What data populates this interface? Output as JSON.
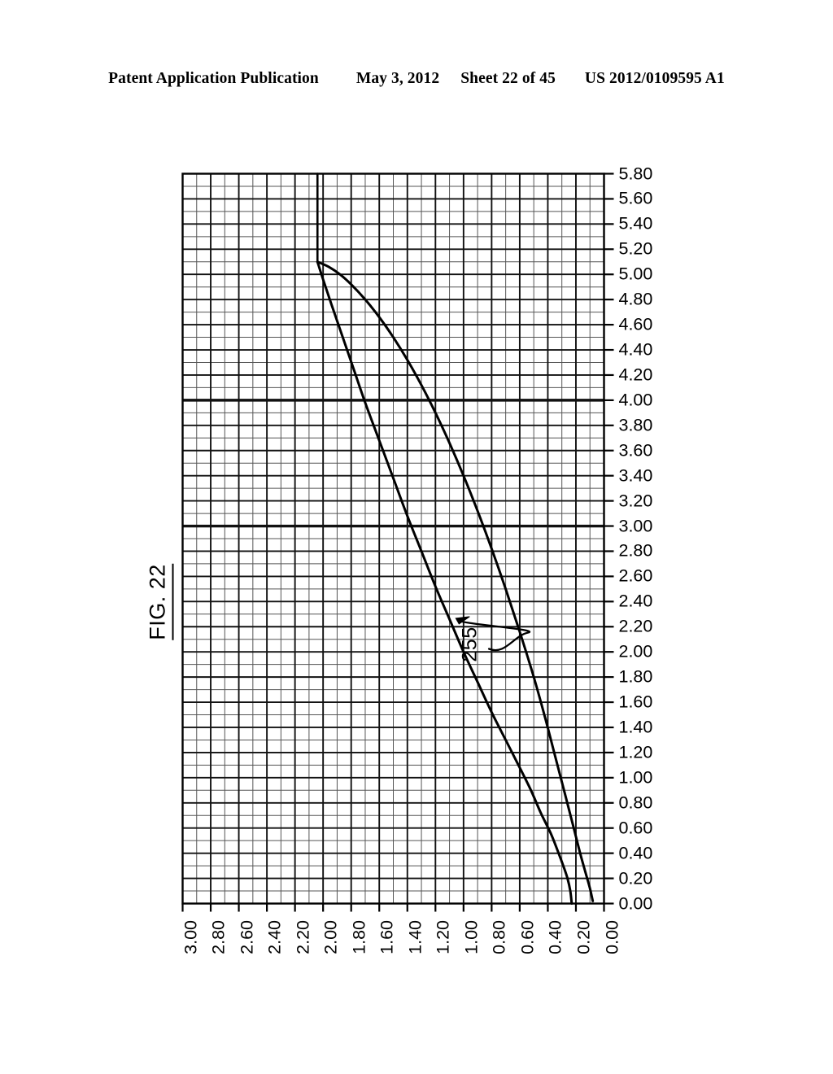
{
  "header": {
    "publication": "Patent Application Publication",
    "date": "May 3, 2012",
    "sheet": "Sheet 22 of 45",
    "patent_number": "US 2012/0109595 A1"
  },
  "figure": {
    "caption": "FIG. 22",
    "reference_numeral": "255"
  },
  "chart_data": {
    "type": "line",
    "title": "FIG. 22",
    "xlabel": "",
    "ylabel": "",
    "grid": true,
    "legend": null,
    "xlim": [
      3.0,
      0.0
    ],
    "ylim": [
      0.0,
      5.8
    ],
    "x_axis_position": "bottom",
    "y_axis_position": "right",
    "x_axis_direction": "descending",
    "xticks": [
      3.0,
      2.8,
      2.6,
      2.4,
      2.2,
      2.0,
      1.8,
      1.6,
      1.4,
      1.2,
      1.0,
      0.8,
      0.6,
      0.4,
      0.2,
      0.0
    ],
    "xtick_labels": [
      "3.00",
      "2.80",
      "2.60",
      "2.40",
      "2.20",
      "2.00",
      "1.80",
      "1.60",
      "1.40",
      "1.20",
      "1.00",
      "0.80",
      "0.60",
      "0.40",
      "0.20",
      "0.00"
    ],
    "yticks": [
      5.8,
      5.6,
      5.4,
      5.2,
      5.0,
      4.8,
      4.6,
      4.4,
      4.2,
      4.0,
      3.8,
      3.6,
      3.4,
      3.2,
      3.0,
      2.8,
      2.6,
      2.4,
      2.2,
      2.0,
      1.8,
      1.6,
      1.4,
      1.2,
      1.0,
      0.8,
      0.6,
      0.4,
      0.2,
      0.0
    ],
    "ytick_labels": [
      "5.80",
      "5.60",
      "5.40",
      "5.20",
      "5.00",
      "4.80",
      "4.60",
      "4.40",
      "4.20",
      "4.00",
      "3.80",
      "3.60",
      "3.40",
      "3.20",
      "3.00",
      "2.80",
      "2.60",
      "2.40",
      "2.20",
      "2.00",
      "1.80",
      "1.60",
      "1.40",
      "1.20",
      "1.00",
      "0.80",
      "0.60",
      "0.40",
      "0.20",
      "0.00"
    ],
    "emphasized_gridlines_y": [
      4.0,
      3.0
    ],
    "minor_grid_divisions": 2,
    "annotations": [
      {
        "text": "255",
        "x": 0.9,
        "y": 2.05,
        "points_to_series": "inner-branch",
        "leader": "curved-with-arrowhead"
      }
    ],
    "series": [
      {
        "name": "vertical-guide",
        "comment": "vertical line from top border down to curve apex",
        "points": [
          [
            2.04,
            5.8
          ],
          [
            2.04,
            5.1
          ]
        ]
      },
      {
        "name": "outer-branch",
        "comment": "upper/outer branch of the closed lens curve",
        "points": [
          [
            2.04,
            5.1
          ],
          [
            1.96,
            5.06
          ],
          [
            1.88,
            5.0
          ],
          [
            1.8,
            4.92
          ],
          [
            1.7,
            4.8
          ],
          [
            1.6,
            4.66
          ],
          [
            1.5,
            4.5
          ],
          [
            1.4,
            4.32
          ],
          [
            1.3,
            4.12
          ],
          [
            1.2,
            3.9
          ],
          [
            1.1,
            3.66
          ],
          [
            1.0,
            3.4
          ],
          [
            0.9,
            3.12
          ],
          [
            0.8,
            2.82
          ],
          [
            0.7,
            2.5
          ],
          [
            0.6,
            2.16
          ],
          [
            0.5,
            1.8
          ],
          [
            0.42,
            1.48
          ],
          [
            0.35,
            1.18
          ],
          [
            0.28,
            0.88
          ],
          [
            0.22,
            0.62
          ],
          [
            0.17,
            0.4
          ],
          [
            0.13,
            0.24
          ],
          [
            0.1,
            0.12
          ],
          [
            0.08,
            0.02
          ]
        ]
      },
      {
        "name": "inner-branch",
        "comment": "lower/inner branch of the closed lens curve",
        "points": [
          [
            2.04,
            5.1
          ],
          [
            2.0,
            4.96
          ],
          [
            1.94,
            4.76
          ],
          [
            1.86,
            4.5
          ],
          [
            1.78,
            4.24
          ],
          [
            1.7,
            3.98
          ],
          [
            1.6,
            3.68
          ],
          [
            1.5,
            3.38
          ],
          [
            1.4,
            3.08
          ],
          [
            1.3,
            2.8
          ],
          [
            1.2,
            2.52
          ],
          [
            1.1,
            2.26
          ],
          [
            1.0,
            2.0
          ],
          [
            0.9,
            1.76
          ],
          [
            0.8,
            1.52
          ],
          [
            0.7,
            1.3
          ],
          [
            0.6,
            1.08
          ],
          [
            0.52,
            0.9
          ],
          [
            0.45,
            0.72
          ],
          [
            0.38,
            0.56
          ],
          [
            0.33,
            0.42
          ],
          [
            0.29,
            0.3
          ],
          [
            0.26,
            0.2
          ],
          [
            0.24,
            0.1
          ],
          [
            0.23,
            0.0
          ]
        ]
      }
    ]
  }
}
